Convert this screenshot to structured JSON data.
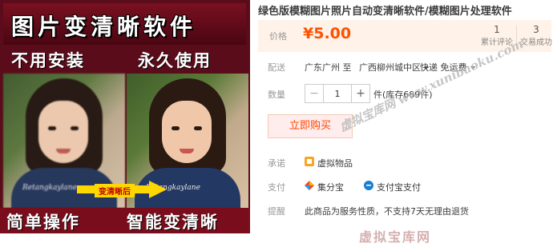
{
  "banner": {
    "headline": "图片变清晰软件",
    "tagline_left": "不用安装",
    "tagline_right": "永久使用",
    "photo_caption": "Retangkaylane",
    "arrow_label": "变清晰后",
    "footer_left": "简单操作",
    "footer_right": "智能变清晰"
  },
  "product": {
    "title": "绿色版模糊图片照片自动变清晰软件/模糊图片处理软件",
    "price_label": "价格",
    "price": "¥5.00",
    "accent_color": "#ff5000",
    "stats": [
      {
        "value": "1",
        "label": "累计评论"
      },
      {
        "value": "3",
        "label": "交易成功"
      }
    ],
    "shipping": {
      "label": "配送",
      "from": "广东广州 至",
      "to": "广西柳州城中区",
      "fee": "快递 免运费"
    },
    "quantity": {
      "label": "数量",
      "minus": "−",
      "plus": "+",
      "value": "1",
      "stock": "件(库存689件)"
    },
    "buy_button": "立即购买",
    "promise": {
      "label": "承诺",
      "icon": "virtual-goods-icon",
      "text": "虚拟物品"
    },
    "payment": {
      "label": "支付",
      "options": [
        {
          "icon": "jifenbao-icon",
          "text": "集分宝"
        },
        {
          "icon": "alipay-icon",
          "text": "支付宝支付"
        }
      ]
    },
    "notice": {
      "label": "提醒",
      "text": "此商品为服务性质，不支持7天无理由退货"
    }
  },
  "watermarks": {
    "diagonal": "虚拟宝库网 www.xunibaoku.com",
    "bottom": "虚拟宝库网"
  }
}
